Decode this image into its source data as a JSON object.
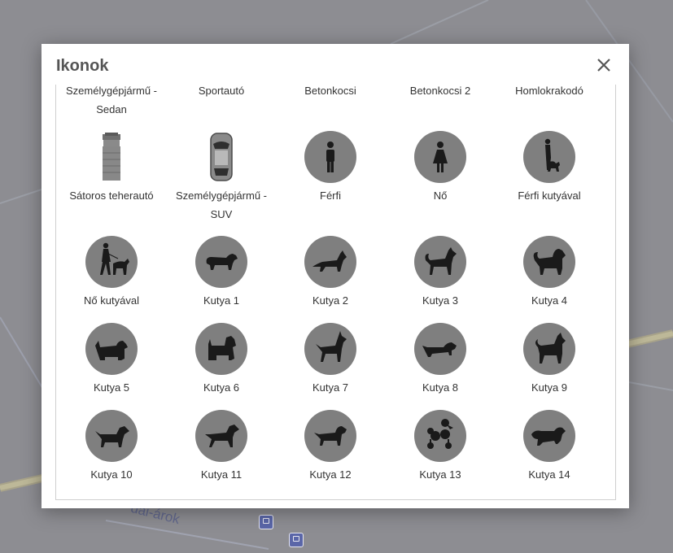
{
  "modal": {
    "title": "Ikonok",
    "close_label": "×"
  },
  "icons": {
    "row0": [
      {
        "label": "Személygépjármű - Sedan"
      },
      {
        "label": "Sportautó"
      },
      {
        "label": "Betonkocsi"
      },
      {
        "label": "Betonkocsi 2"
      },
      {
        "label": "Homlokrakodó"
      }
    ],
    "row1": [
      {
        "label": "Sátoros teherautó",
        "icon": "truck-icon"
      },
      {
        "label": "Személygépjármű - SUV",
        "icon": "car-icon"
      },
      {
        "label": "Férfi",
        "icon": "man-icon"
      },
      {
        "label": "Nő",
        "icon": "woman-icon"
      },
      {
        "label": "Férfi kutyával",
        "icon": "man-with-dog-icon"
      }
    ],
    "row2": [
      {
        "label": "Nő kutyával",
        "icon": "woman-with-dog-icon"
      },
      {
        "label": "Kutya 1",
        "icon": "dog-icon"
      },
      {
        "label": "Kutya 2",
        "icon": "dog-icon"
      },
      {
        "label": "Kutya 3",
        "icon": "dog-icon"
      },
      {
        "label": "Kutya 4",
        "icon": "dog-icon"
      }
    ],
    "row3": [
      {
        "label": "Kutya 5",
        "icon": "dog-icon"
      },
      {
        "label": "Kutya 6",
        "icon": "dog-icon"
      },
      {
        "label": "Kutya 7",
        "icon": "dog-icon"
      },
      {
        "label": "Kutya 8",
        "icon": "dog-icon"
      },
      {
        "label": "Kutya 9",
        "icon": "dog-icon"
      }
    ],
    "row4": [
      {
        "label": "Kutya 10",
        "icon": "dog-icon"
      },
      {
        "label": "Kutya 11",
        "icon": "dog-icon"
      },
      {
        "label": "Kutya 12",
        "icon": "dog-icon"
      },
      {
        "label": "Kutya 13",
        "icon": "dog-icon"
      },
      {
        "label": "Kutya 14",
        "icon": "dog-icon"
      }
    ]
  },
  "map": {
    "street_label": "dai-árok"
  },
  "colors": {
    "icon_circle": "#7f7f7f",
    "silhouette": "#1a1a1a",
    "backdrop": "#8d8d92"
  }
}
